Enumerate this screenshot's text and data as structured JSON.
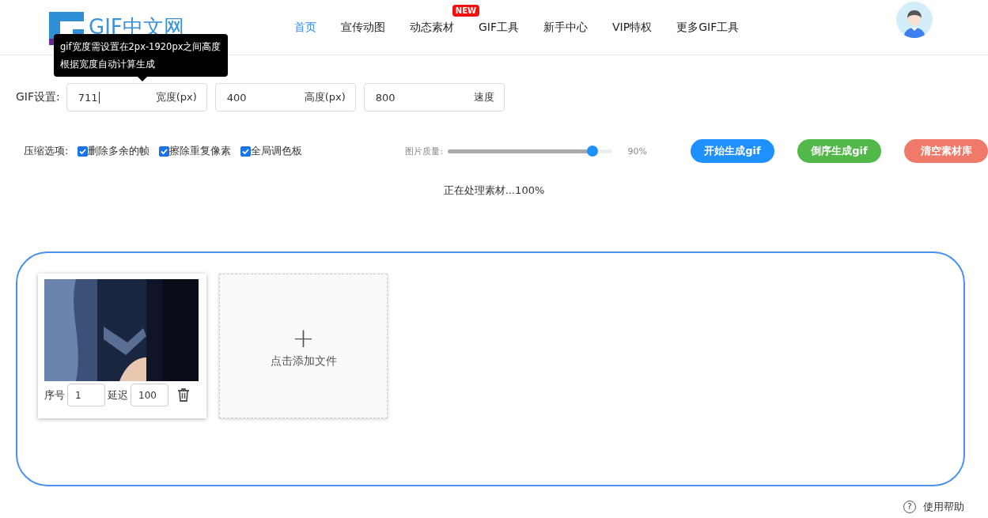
{
  "header": {
    "logo_text": "GIF中文网",
    "nav": [
      {
        "label": "首页",
        "selected": true
      },
      {
        "label": "宣传动图",
        "selected": false
      },
      {
        "label": "动态素材",
        "selected": false,
        "badge": "NEW"
      },
      {
        "label": "GIF工具",
        "selected": false
      },
      {
        "label": "新手中心",
        "selected": false
      },
      {
        "label": "VIP特权",
        "selected": false
      },
      {
        "label": "更多GIF工具",
        "selected": false
      }
    ]
  },
  "tooltip": {
    "lines": [
      "gif宽度需设置在2px-1920px之间高度",
      "根据宽度自动计算生成"
    ]
  },
  "settings": {
    "label": "GIF设置:",
    "fields": [
      {
        "value": "711",
        "unit": "宽度(px)"
      },
      {
        "value": "400",
        "unit": "高度(px)"
      },
      {
        "value": "800",
        "unit": "速度"
      }
    ]
  },
  "compression": {
    "label": "压缩选项:",
    "options": [
      {
        "label": "删除多余的帧",
        "checked": true
      },
      {
        "label": "擦除重复像素",
        "checked": true
      },
      {
        "label": "全局调色板",
        "checked": true
      }
    ],
    "quality": {
      "label": "图片质量:",
      "level": 0.88,
      "reading": "90%"
    }
  },
  "actions": [
    {
      "label": "开始生成gif",
      "color": "#1e90ff"
    },
    {
      "label": "倒序生成gif",
      "color": "#52b84a"
    },
    {
      "label": "清空素材库",
      "color": "#f07a6a"
    }
  ],
  "status": "正在处理素材...100%",
  "frames": [
    {
      "kind": "picture",
      "order_label": "序号",
      "order": "1",
      "delay_label": "延迟",
      "delay": "100"
    }
  ],
  "add_file": {
    "plus": "+",
    "label": "点击添加文件"
  },
  "help": {
    "icon": "?",
    "label": "使用帮助"
  }
}
